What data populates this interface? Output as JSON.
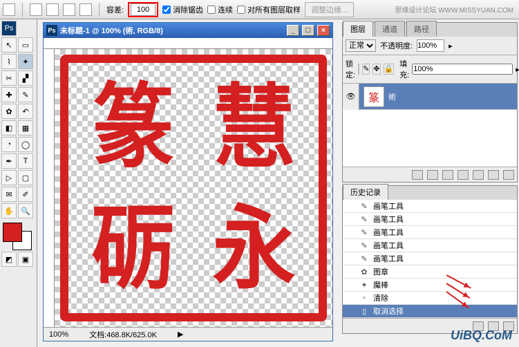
{
  "topbar": {
    "tolerance_label": "容差:",
    "tolerance_value": "100",
    "antialias": "消除锯齿",
    "contiguous": "连续",
    "sample_all": "对所有图层取样",
    "refine": "调整边缘..."
  },
  "watermark": "思缘设计论坛  WWW.MISSYUAN.COM",
  "doc": {
    "title": "未标题-1 @ 100% (術, RGB/8)",
    "zoom": "100%",
    "status": "文档:468.8K/625.0K"
  },
  "layers": {
    "tab1": "图层",
    "tab2": "通道",
    "tab3": "路径",
    "blend": "正常",
    "opacity_label": "不透明度:",
    "opacity": "100%",
    "lock_label": "锁定:",
    "fill_label": "填充:",
    "fill": "100%",
    "layer_name": "術"
  },
  "history": {
    "tab": "历史记录",
    "items": [
      {
        "icon": "✎",
        "label": "画笔工具"
      },
      {
        "icon": "✎",
        "label": "画笔工具"
      },
      {
        "icon": "✎",
        "label": "画笔工具"
      },
      {
        "icon": "✎",
        "label": "画笔工具"
      },
      {
        "icon": "✎",
        "label": "画笔工具"
      },
      {
        "icon": "✿",
        "label": "图章"
      },
      {
        "icon": "✦",
        "label": "魔棒"
      },
      {
        "icon": "▫",
        "label": "清除"
      },
      {
        "icon": "▯",
        "label": "取消选择"
      }
    ]
  },
  "brand": "UiBQ.CoM"
}
